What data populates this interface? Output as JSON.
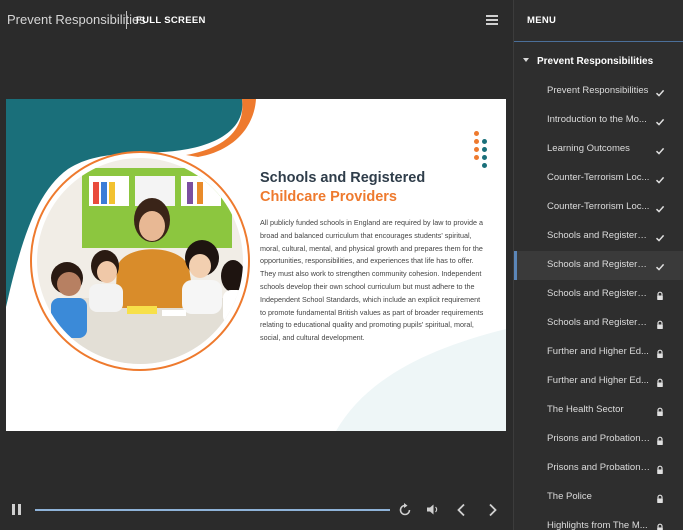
{
  "header": {
    "course_title": "Prevent Responsibilities",
    "fullscreen_label": "FULL SCREEN"
  },
  "slide": {
    "heading_main": "Schools and Registered ",
    "heading_accent": "Childcare Providers",
    "body": "All publicly funded schools in England are required by law to provide a broad and balanced curriculum that encourages students' spiritual, moral, cultural, mental, and physical growth and prepares them for the opportunities, responsibilities, and experiences that life has to offer. They must also work to strengthen community cohesion. Independent schools develop their own school curriculum but must adhere to the Independent School Standards, which include an explicit requirement to promote fundamental British values as part of broader requirements relating to educational quality and promoting pupils' spiritual, moral, social, and cultural development.",
    "colors": {
      "teal": "#1a6f7a",
      "orange": "#ee7a2e",
      "heading": "#2f3d4a"
    }
  },
  "player": {
    "progress": 1.0
  },
  "sidebar": {
    "menu_label": "MENU",
    "section_label": "Prevent Responsibilities",
    "items": [
      {
        "label": "Prevent Responsibilities",
        "status": "check-icon",
        "active": false
      },
      {
        "label": "Introduction to the Mo...",
        "status": "check-icon",
        "active": false
      },
      {
        "label": "Learning Outcomes",
        "status": "check-icon",
        "active": false
      },
      {
        "label": "Counter-Terrorism Loc...",
        "status": "check-icon",
        "active": false
      },
      {
        "label": "Counter-Terrorism Loc...",
        "status": "check-icon",
        "active": false
      },
      {
        "label": "Schools and Registered...",
        "status": "check-icon",
        "active": false
      },
      {
        "label": "Schools and Registered...",
        "status": "check-icon",
        "active": true
      },
      {
        "label": "Schools and Registered...",
        "status": "lock-icon",
        "active": false
      },
      {
        "label": "Schools and Registered...",
        "status": "lock-icon",
        "active": false
      },
      {
        "label": "Further and Higher Ed...",
        "status": "lock-icon",
        "active": false
      },
      {
        "label": "Further and Higher Ed...",
        "status": "lock-icon",
        "active": false
      },
      {
        "label": "The Health Sector",
        "status": "lock-icon",
        "active": false
      },
      {
        "label": "Prisons and Probation -...",
        "status": "lock-icon",
        "active": false
      },
      {
        "label": "Prisons and Probation -...",
        "status": "lock-icon",
        "active": false
      },
      {
        "label": "The Police",
        "status": "lock-icon",
        "active": false
      },
      {
        "label": "Highlights from The M...",
        "status": "lock-icon",
        "active": false
      }
    ]
  }
}
